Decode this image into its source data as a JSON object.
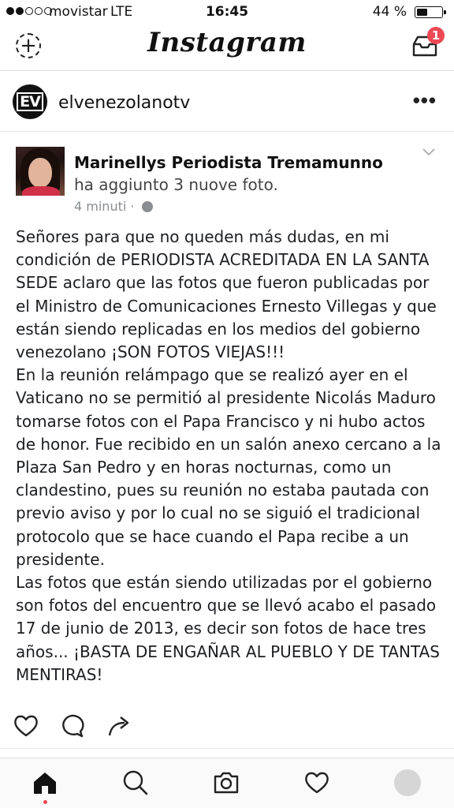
{
  "status_bar": {
    "carrier": "movistar",
    "network": "LTE",
    "time": "16:45",
    "battery_percent": "44 %",
    "battery_level": 0.44,
    "signal_bars": 2
  },
  "header": {
    "logo": "Instagram",
    "add_icon": "plus-circle-icon",
    "inbox_icon": "inbox-icon",
    "inbox_badge": "1",
    "badge_color": "#ed4956"
  },
  "post": {
    "avatar_text": "EV",
    "username": "elvenezolanotv",
    "more_icon": "more-horizontal-icon"
  },
  "fb_post": {
    "author": "Marinellys Periodista Tremamunno",
    "action_text": " ha aggiunto 3 nuove foto.",
    "time": "4 minuti",
    "separator": "·",
    "body": [
      "Señores para que no queden más dudas, en mi condición de PERIODISTA ACREDITADA EN LA SANTA SEDE aclaro que las fotos que fueron publicadas por el Ministro de Comunicaciones Ernesto Villegas y que están siendo replicadas en los medios del gobierno venezolano ¡SON FOTOS VIEJAS!!!",
      "En la reunión relámpago que se realizó ayer en el Vaticano no se permitió al presidente Nicolás Maduro tomarse fotos con el Papa Francisco y ni hubo actos de honor. Fue recibido en un salón anexo cercano a la Plaza San Pedro y en horas nocturnas, como un clandestino, pues su reunión no estaba pautada con previo aviso y por lo cual no se siguió el tradicional protocolo que se hace cuando el Papa recibe a un presidente.",
      "Las fotos que están siendo utilizadas por el gobierno son fotos del encuentro que se llevó acabo el pasado 17 de junio de 2013, es decir son fotos de hace tres años... ¡BASTA DE ENGAÑAR AL PUEBLO Y DE TANTAS MENTIRAS!"
    ]
  },
  "actions": [
    "heart-icon",
    "comment-icon",
    "share-icon"
  ],
  "tabbar": [
    "home-icon",
    "search-icon",
    "camera-icon",
    "activity-heart-icon",
    "profile-icon"
  ]
}
